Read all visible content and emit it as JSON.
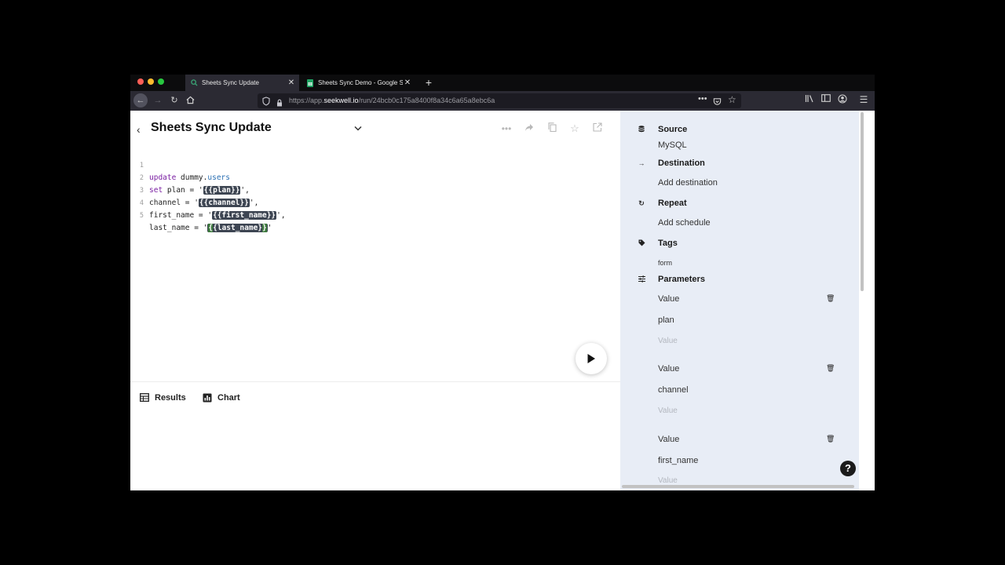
{
  "browser": {
    "tabs": [
      {
        "title": "Sheets Sync Update",
        "icon": "search-tab-icon",
        "active": true
      },
      {
        "title": "Sheets Sync Demo - Google Sh",
        "icon": "google-sheets-icon",
        "active": false
      }
    ],
    "url": {
      "prefix": "https://app.",
      "domain": "seekwell.io",
      "path": "/run/24bcb0c175a8400f8a34c6a65a8ebc6a"
    }
  },
  "query": {
    "title": "Sheets Sync Update",
    "lines": [
      {
        "num": "1"
      },
      {
        "num": "2"
      },
      {
        "num": "3"
      },
      {
        "num": "4"
      },
      {
        "num": "5"
      }
    ],
    "code": {
      "l1_kw": "update",
      "l1_schema": " dummy.",
      "l1_table": "users",
      "l2_kw": "set",
      "l2_text": " plan = '",
      "l2_param": "{{plan}}",
      "l2_end": "',",
      "l3_text": "channel = '",
      "l3_param": "{{channel}}",
      "l3_end": "',",
      "l4_text": "first_name = '",
      "l4_param": "{{first_name}}",
      "l4_end": "',",
      "l5_text": "last_name = '",
      "l5_param_a": "{",
      "l5_param_b": "{last_name}",
      "l5_param_c": "}",
      "l5_end": "'"
    }
  },
  "results_tabs": {
    "results": "Results",
    "chart": "Chart"
  },
  "sidebar": {
    "source": {
      "label": "Source",
      "value": "MySQL"
    },
    "destination": {
      "label": "Destination",
      "value": "Add destination"
    },
    "repeat": {
      "label": "Repeat",
      "value": "Add schedule"
    },
    "tags": {
      "label": "Tags",
      "value": "form"
    },
    "parameters": {
      "label": "Parameters",
      "items": [
        {
          "value_label": "Value",
          "name": "plan",
          "placeholder": "Value"
        },
        {
          "value_label": "Value",
          "name": "channel",
          "placeholder": "Value"
        },
        {
          "value_label": "Value",
          "name": "first_name",
          "placeholder": "Value"
        }
      ]
    }
  },
  "colors": {
    "sidebar_bg": "#e8edf6",
    "param_bg": "#3d4552",
    "keyword": "#7a1fa2",
    "table": "#2a6fb3"
  }
}
